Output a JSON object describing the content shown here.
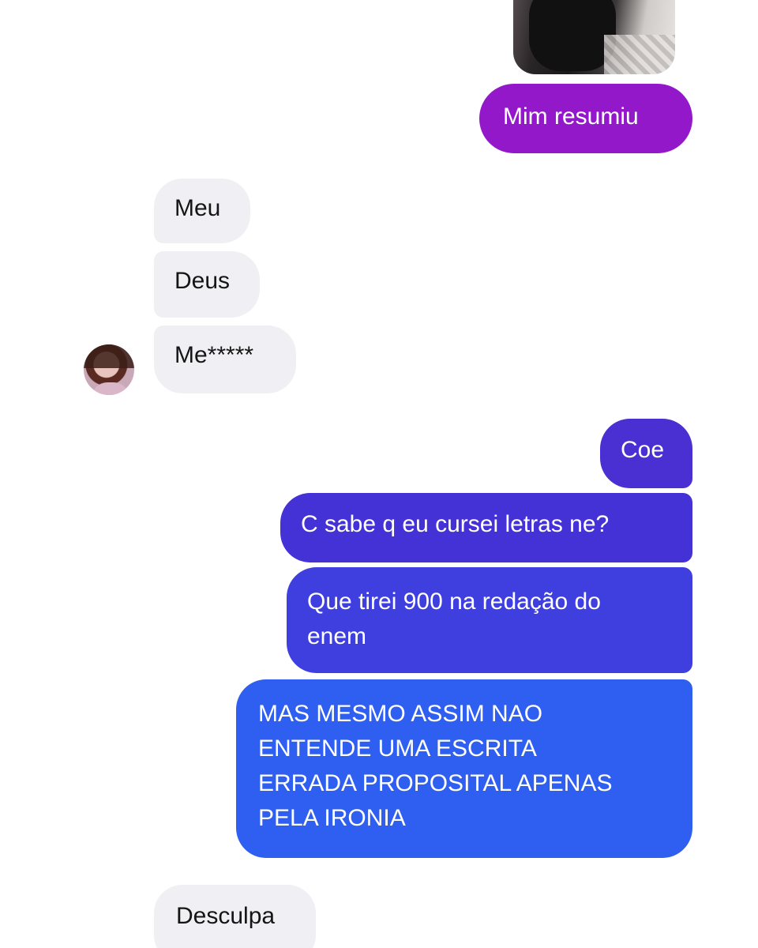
{
  "conversation": {
    "messages": [
      {
        "from": "me",
        "text": "Mim resumiu",
        "color": "#9218c9"
      },
      {
        "from": "them",
        "text": "Meu"
      },
      {
        "from": "them",
        "text": "Deus"
      },
      {
        "from": "them",
        "text": "Me*****"
      },
      {
        "from": "me",
        "text": "Coe",
        "color": "#4a2fd2"
      },
      {
        "from": "me",
        "text": "C sabe q eu cursei letras ne?",
        "color": "#4532d7"
      },
      {
        "from": "me",
        "text": "Que tirei 900 na redação do\nenem",
        "color": "#3f3fe0"
      },
      {
        "from": "me",
        "text": "MAS MESMO ASSIM NAO\nENTENDE UMA ESCRITA\nERRADA PROPOSITAL APENAS\nPELA IRONIA",
        "color": "#2f5ff0"
      },
      {
        "from": "them",
        "text": "Desculpa"
      }
    ]
  },
  "colors": {
    "incoming_bubble": "#f0eff3",
    "background": "#ffffff"
  }
}
